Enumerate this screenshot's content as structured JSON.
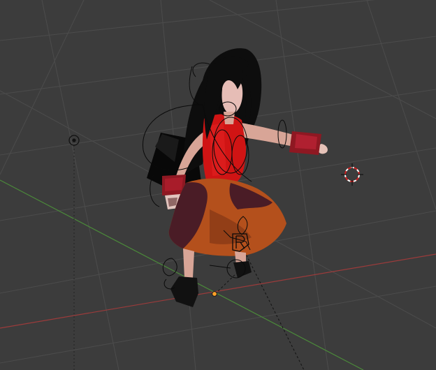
{
  "viewport": {
    "background": "#3c3c3c",
    "grid_color": "#4d4d4d",
    "x_axis_color": "#9c3b3b",
    "y_axis_color": "#4b8a3a",
    "scene": {
      "character": "girl-with-long-black-hair",
      "outfit_colors": {
        "hair": "#101010",
        "skin": "#d9a99a",
        "top": "#d01414",
        "cuffs": "#8e1822",
        "skirt_outer": "#b4501c",
        "skirt_inner": "#4a1c26",
        "shoes": "#111111"
      },
      "overlays": [
        "armature-rig-curves",
        "3d-cursor",
        "lamp-object",
        "object-origin"
      ]
    }
  }
}
